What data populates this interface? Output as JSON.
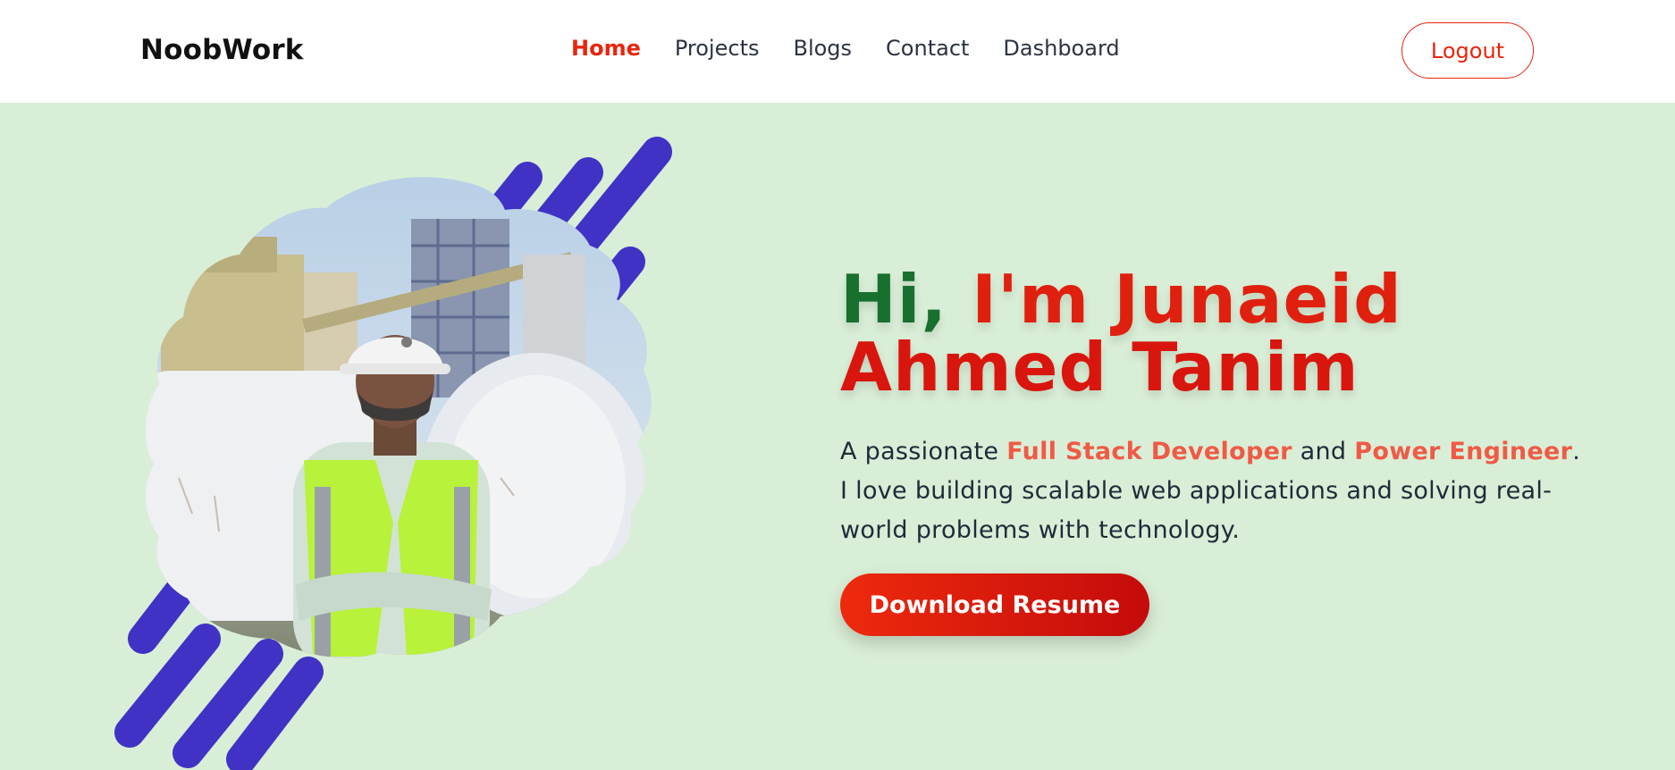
{
  "navbar": {
    "brand": "NoobWork",
    "links": [
      {
        "label": "Home",
        "active": true
      },
      {
        "label": "Projects",
        "active": false
      },
      {
        "label": "Blogs",
        "active": false
      },
      {
        "label": "Contact",
        "active": false
      },
      {
        "label": "Dashboard",
        "active": false
      }
    ],
    "logout_label": "Logout"
  },
  "hero": {
    "greeting": "Hi,",
    "name_first": "I'm Junaeid",
    "name_last": "Ahmed Tanim",
    "description": {
      "prefix": "A passionate ",
      "highlight_1": "Full Stack Developer",
      "mid": " and ",
      "highlight_2": "Power Engineer",
      "suffix": ". I love building scalable web applications and solving real-world problems with technology."
    },
    "download_label": "Download Resume",
    "profile_photo": "profile-photo"
  },
  "colors": {
    "accent": "#e8250c",
    "greeting_green": "#17702e",
    "hero_bg": "#d9eed6",
    "stripe_blue": "#3f32c4",
    "highlight": "#ef5a46"
  }
}
